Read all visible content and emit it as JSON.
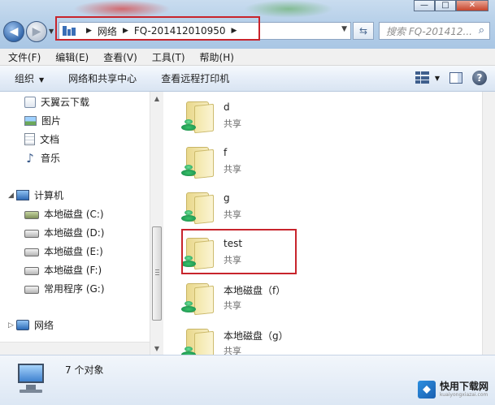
{
  "window": {
    "buttons": {
      "minimize": "—",
      "maximize": "□",
      "close": "✕"
    }
  },
  "address": {
    "segments": [
      "网络",
      "FQ-201412010950"
    ]
  },
  "search": {
    "placeholder": "搜索 FQ-201412..."
  },
  "menu": [
    "文件(F)",
    "编辑(E)",
    "查看(V)",
    "工具(T)",
    "帮助(H)"
  ],
  "commands": {
    "organize": "组织",
    "network_center": "网络和共享中心",
    "remote_printers": "查看远程打印机"
  },
  "nav": {
    "favorites": [
      {
        "label": "天翼云下载",
        "icon": "cloud-folder-icon"
      },
      {
        "label": "图片",
        "icon": "pictures-icon"
      },
      {
        "label": "文档",
        "icon": "documents-icon"
      },
      {
        "label": "音乐",
        "icon": "music-icon"
      }
    ],
    "computer": {
      "label": "计算机",
      "drives": [
        "本地磁盘 (C:)",
        "本地磁盘 (D:)",
        "本地磁盘 (E:)",
        "本地磁盘 (F:)",
        "常用程序 (G:)"
      ]
    },
    "network": "网络"
  },
  "shares": [
    {
      "name": "d",
      "sub": "共享"
    },
    {
      "name": "f",
      "sub": "共享"
    },
    {
      "name": "g",
      "sub": "共享"
    },
    {
      "name": "test",
      "sub": "共享"
    },
    {
      "name": "本地磁盘（f）",
      "sub": "共享"
    },
    {
      "name": "本地磁盘（g）",
      "sub": "共享"
    }
  ],
  "details": {
    "count": "7 个对象"
  },
  "watermark": {
    "title": "快用下载网",
    "url": "kuaiyongxiazai.com"
  },
  "colors": {
    "highlight": "#c8242c",
    "address_bg": "#ffffff",
    "chrome": "#b7d0e9"
  }
}
